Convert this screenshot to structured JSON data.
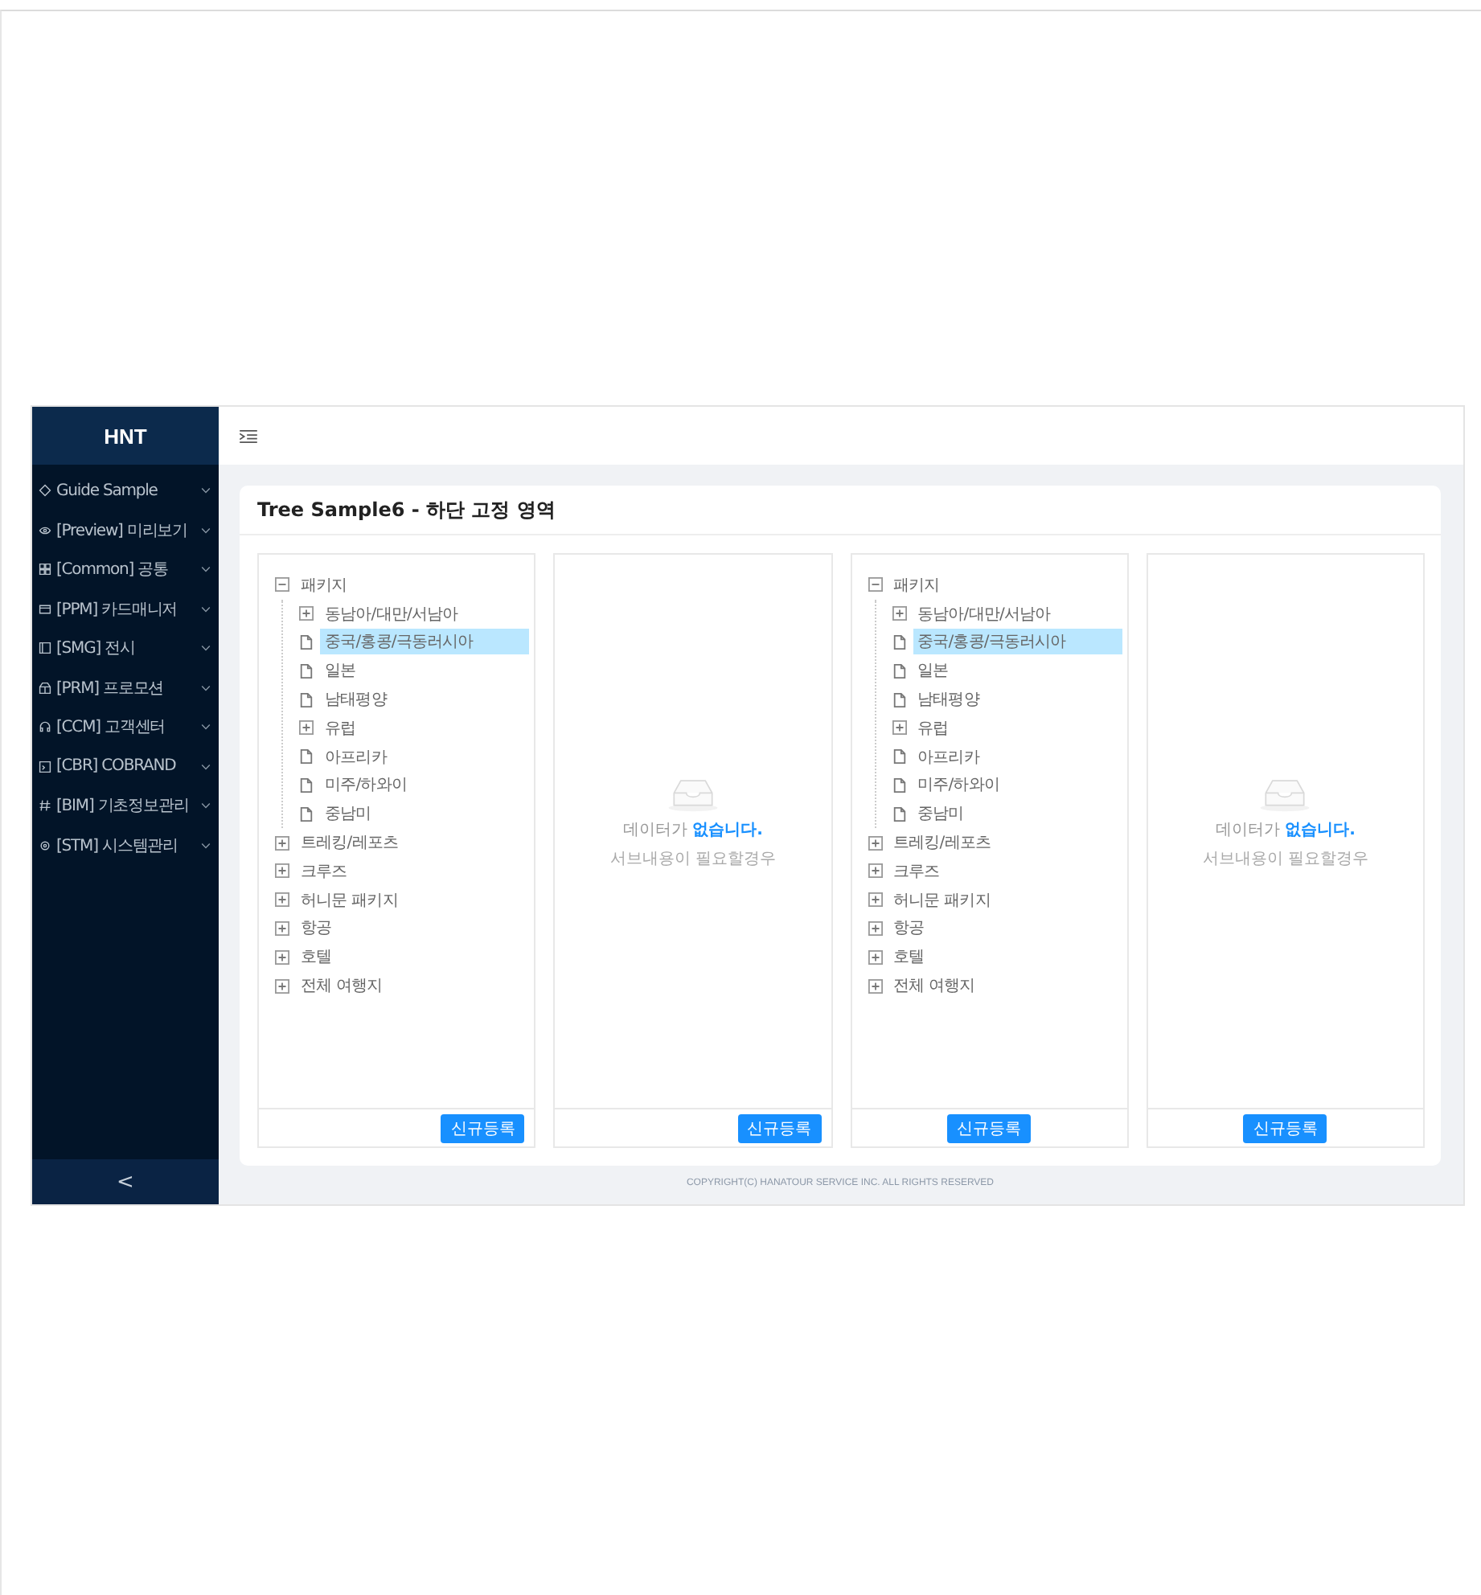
{
  "sidebar": {
    "logo": "HNT",
    "items": [
      {
        "label": "Guide Sample",
        "expanded": false
      },
      {
        "label": "[Preview] 미리보기",
        "expanded": false
      },
      {
        "label": "[Common] 공통",
        "expanded": false
      },
      {
        "label": "[PPM] 카드매니저",
        "expanded": false
      },
      {
        "label": "[SMG] 전시",
        "expanded": false
      },
      {
        "label": "[PRM] 프로모션",
        "expanded": false
      },
      {
        "label": "[CCM] 고객센터",
        "expanded": false
      },
      {
        "label": "[CBR] COBRAND",
        "expanded": false
      },
      {
        "label": "[BIM] 기초정보관리",
        "expanded": false
      },
      {
        "label": "[STM] 시스템관리",
        "expanded": false
      }
    ],
    "collapse_button": "<"
  },
  "card": {
    "title": "Tree Sample6 - 하단 고정 영역",
    "panels": [
      {
        "kind": "tree",
        "button": "신규등록",
        "button_centered": false,
        "tree": [
          {
            "label": "패키지",
            "kind": "folder",
            "expanded": true,
            "selected": false,
            "children": [
              {
                "label": "동남아/대만/서남아",
                "kind": "folder",
                "expanded": false,
                "selected": false
              },
              {
                "label": "중국/홍콩/극동러시아",
                "kind": "file",
                "selected": true
              },
              {
                "label": "일본",
                "kind": "file",
                "selected": false
              },
              {
                "label": "남태평양",
                "kind": "file",
                "selected": false
              },
              {
                "label": "유럽",
                "kind": "folder",
                "expanded": false,
                "selected": false
              },
              {
                "label": "아프리카",
                "kind": "file",
                "selected": false
              },
              {
                "label": "미주/하와이",
                "kind": "file",
                "selected": false
              },
              {
                "label": "중남미",
                "kind": "file",
                "selected": false
              }
            ]
          },
          {
            "label": "트레킹/레포츠",
            "kind": "folder",
            "expanded": false,
            "selected": false
          },
          {
            "label": "크루즈",
            "kind": "folder",
            "expanded": false,
            "selected": false
          },
          {
            "label": "허니문 패키지",
            "kind": "folder",
            "expanded": false,
            "selected": false
          },
          {
            "label": "항공",
            "kind": "folder",
            "expanded": false,
            "selected": false
          },
          {
            "label": "호텔",
            "kind": "folder",
            "expanded": false,
            "selected": false
          },
          {
            "label": "전체 여행지",
            "kind": "folder",
            "expanded": false,
            "selected": false
          }
        ]
      },
      {
        "kind": "empty",
        "button": "신규등록",
        "button_centered": false,
        "message": "데이터가 **없습니다.**",
        "sub_message": "서브내용이 필요할경우"
      },
      {
        "kind": "tree",
        "button": "신규등록",
        "button_centered": true,
        "tree": [
          {
            "label": "패키지",
            "kind": "folder",
            "expanded": true,
            "selected": false,
            "children": [
              {
                "label": "동남아/대만/서남아",
                "kind": "folder",
                "expanded": false,
                "selected": false
              },
              {
                "label": "중국/홍콩/극동러시아",
                "kind": "file",
                "selected": true
              },
              {
                "label": "일본",
                "kind": "file",
                "selected": false
              },
              {
                "label": "남태평양",
                "kind": "file",
                "selected": false
              },
              {
                "label": "유럽",
                "kind": "folder",
                "expanded": false,
                "selected": false
              },
              {
                "label": "아프리카",
                "kind": "file",
                "selected": false
              },
              {
                "label": "미주/하와이",
                "kind": "file",
                "selected": false
              },
              {
                "label": "중남미",
                "kind": "file",
                "selected": false
              }
            ]
          },
          {
            "label": "트레킹/레포츠",
            "kind": "folder",
            "expanded": false,
            "selected": false
          },
          {
            "label": "크루즈",
            "kind": "folder",
            "expanded": false,
            "selected": false
          },
          {
            "label": "허니문 패키지",
            "kind": "folder",
            "expanded": false,
            "selected": false
          },
          {
            "label": "항공",
            "kind": "folder",
            "expanded": false,
            "selected": false
          },
          {
            "label": "호텔",
            "kind": "folder",
            "expanded": false,
            "selected": false
          },
          {
            "label": "전체 여행지",
            "kind": "folder",
            "expanded": false,
            "selected": false
          }
        ]
      },
      {
        "kind": "empty",
        "button": "신규등록",
        "button_centered": true,
        "message": "데이터가 **없습니다.**",
        "sub_message": "서브내용이 필요할경우"
      }
    ]
  },
  "footer": "COPYRIGHT(C) HANATOUR SERVICE INC. ALL RIGHTS RESERVED"
}
